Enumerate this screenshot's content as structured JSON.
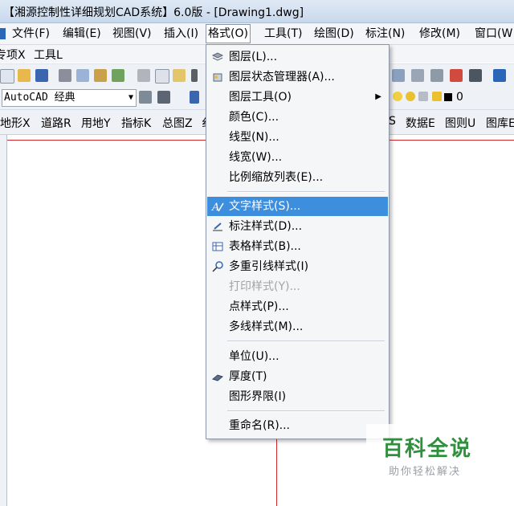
{
  "window": {
    "title": "【湘源控制性详细规划CAD系统】6.0版 - [Drawing1.dwg]"
  },
  "menubar": [
    {
      "id": "file",
      "label": "文件(F)"
    },
    {
      "id": "edit",
      "label": "编辑(E)"
    },
    {
      "id": "view",
      "label": "视图(V)"
    },
    {
      "id": "insert",
      "label": "插入(I)"
    },
    {
      "id": "format",
      "label": "格式(O)"
    },
    {
      "id": "tools",
      "label": "工具(T)"
    },
    {
      "id": "draw",
      "label": "绘图(D)"
    },
    {
      "id": "dimension",
      "label": "标注(N)"
    },
    {
      "id": "modify",
      "label": "修改(M)"
    },
    {
      "id": "window",
      "label": "窗口(W"
    }
  ],
  "menubar2": [
    "专项X",
    "工具L"
  ],
  "workspace_combo": {
    "value": "AutoCAD 经典"
  },
  "layer": {
    "value": "0"
  },
  "menubar3": {
    "left": [
      "地形X",
      "道路R",
      "用地Y",
      "指标K",
      "总图Z",
      "纟"
    ],
    "right": [
      "S",
      "数据E",
      "图则U",
      "图库E"
    ]
  },
  "format_menu": {
    "items": [
      {
        "label": "图层(L)...",
        "icon": "layers-icon"
      },
      {
        "label": "图层状态管理器(A)...",
        "icon": "layer-state-icon"
      },
      {
        "label": "图层工具(O)",
        "submenu": true
      },
      {
        "label": "颜色(C)..."
      },
      {
        "label": "线型(N)..."
      },
      {
        "label": "线宽(W)..."
      },
      {
        "label": "比例缩放列表(E)..."
      },
      {
        "label": "文字样式(S)...",
        "icon": "text-style-icon",
        "selected": true
      },
      {
        "label": "标注样式(D)...",
        "icon": "dim-style-icon"
      },
      {
        "label": "表格样式(B)...",
        "icon": "table-style-icon"
      },
      {
        "label": "多重引线样式(I)",
        "icon": "mleader-style-icon"
      },
      {
        "label": "打印样式(Y)...",
        "disabled": true
      },
      {
        "label": "点样式(P)..."
      },
      {
        "label": "多线样式(M)..."
      },
      {
        "label": "单位(U)..."
      },
      {
        "label": "厚度(T)",
        "icon": "thickness-icon"
      },
      {
        "label": "图形界限(I)"
      },
      {
        "label": "重命名(R)..."
      }
    ]
  },
  "watermark": {
    "main": "百科全说",
    "sub": "助你轻松解决"
  },
  "colors": {
    "selection": "#3e8ede",
    "drawing_line": "#d2282c",
    "watermark": "#2f8f3c"
  }
}
